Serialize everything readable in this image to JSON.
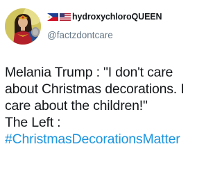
{
  "tweet": {
    "author": {
      "name": "hydroxychloroQUEEN",
      "handle": "@factzdontcare",
      "flag_icons": [
        "philippines-flag-icon",
        "us-flag-icon"
      ],
      "avatar": "wonder-woman-avatar"
    },
    "text_lines": [
      "Melania Trump : \"I don't care",
      "about Christmas decorations. I",
      "care about the children!\"",
      "The Left :"
    ],
    "hashtag": "#ChristmasDecorationsMatter",
    "colors": {
      "text": "#14171a",
      "handle": "#657786",
      "hashtag": "#1b95e0"
    }
  }
}
